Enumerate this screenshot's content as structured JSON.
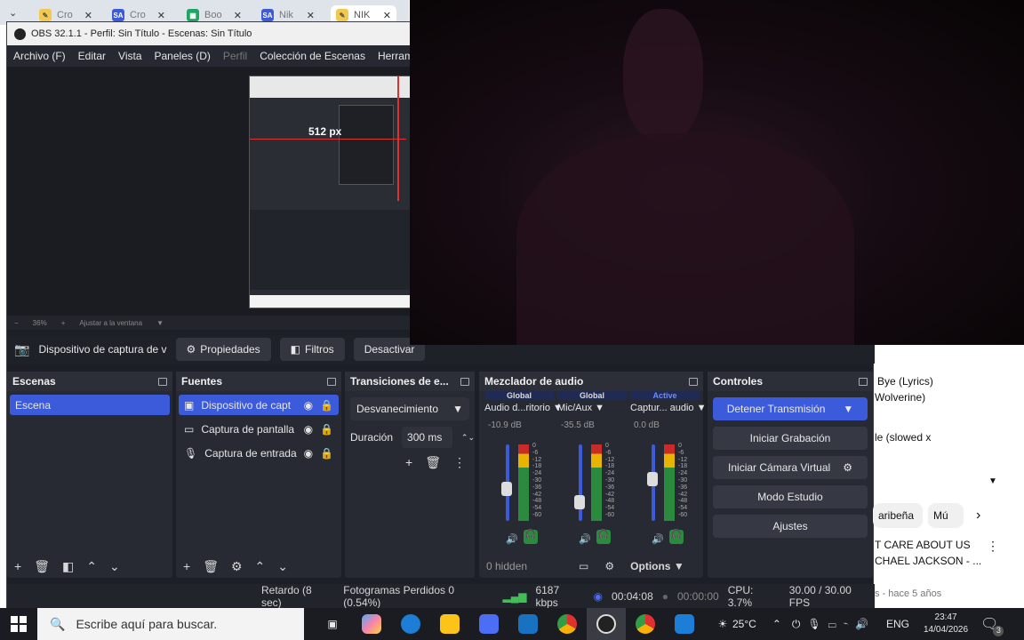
{
  "browser_tabs": [
    {
      "label": "Cro",
      "fav": "",
      "fav_color": "#f2c94c"
    },
    {
      "label": "Cro",
      "fav": "SA",
      "fav_color": "#3b5bdb"
    },
    {
      "label": "Boo",
      "fav": "",
      "fav_color": "#1fa463"
    },
    {
      "label": "Nik",
      "fav": "SA",
      "fav_color": "#3b5bdb"
    },
    {
      "label": "NIK",
      "fav": "",
      "fav_color": "#f2c94c"
    }
  ],
  "obs": {
    "title": "OBS 32.1.1 - Perfil: Sin Título - Escenas: Sin Título",
    "menu": [
      "Archivo (F)",
      "Editar",
      "Vista",
      "Paneles (D)",
      "Perfil",
      "Colección de Escenas",
      "Herramie"
    ],
    "preview_overlay_text": "512 px",
    "zoom": {
      "value": "36%",
      "fit": "Ajustar a la ventana"
    },
    "source_toolbar": {
      "source_name": "Dispositivo de captura de v",
      "properties": "Propiedades",
      "filters": "Filtros",
      "deactivate": "Desactivar"
    },
    "scenes": {
      "title": "Escenas",
      "items": [
        "Escena"
      ]
    },
    "sources": {
      "title": "Fuentes",
      "items": [
        {
          "label": "Dispositivo de capt",
          "icon": "camera-icon"
        },
        {
          "label": "Captura de pantalla",
          "icon": "monitor-icon"
        },
        {
          "label": "Captura de entrada",
          "icon": "microphone-icon"
        }
      ]
    },
    "transitions": {
      "title": "Transiciones de e...",
      "selected": "Desvanecimiento",
      "duration_label": "Duración",
      "duration_value": "300 ms"
    },
    "mixer": {
      "title": "Mezclador de audio",
      "channels": [
        {
          "tag": "Global",
          "name": "Audio d...ritorio",
          "db": "-10.9 dB",
          "level": 0.42
        },
        {
          "tag": "Global",
          "name": "Mic/Aux",
          "db": "-35.5 dB",
          "level": 0.25
        },
        {
          "tag": "Active",
          "name": "Captur... audio",
          "db": "0.0 dB",
          "level": 0.55
        }
      ],
      "scale": [
        "0",
        "-6",
        "-12",
        "-18",
        "-24",
        "-30",
        "-36",
        "-42",
        "-48",
        "-54",
        "-60"
      ],
      "hidden": "0 hidden",
      "options": "Options"
    },
    "controls": {
      "title": "Controles",
      "stop_stream": "Detener Transmisión",
      "start_record": "Iniciar Grabación",
      "virtual_cam": "Iniciar Cámara Virtual",
      "studio_mode": "Modo Estudio",
      "settings": "Ajustes"
    },
    "status": {
      "delay": "Retardo (8 sec)",
      "dropped": "Fotogramas Perdidos 0 (0.54%)",
      "bitrate": "6187 kbps",
      "stream_time": "00:04:08",
      "rec_time": "00:00:00",
      "cpu": "CPU: 3.7%",
      "fps": "30.00 / 30.00 FPS"
    }
  },
  "youtube": {
    "line1": "Bye (Lyrics)",
    "line2": "Wolverine)",
    "line3": "le (slowed x",
    "chips": [
      "aribeña",
      "Mú"
    ],
    "title1": "T CARE ABOUT US",
    "title2": "CHAEL JACKSON - ...",
    "meta": "s - hace 5 años"
  },
  "taskbar": {
    "search_placeholder": "Escribe aquí para buscar.",
    "weather": "25°C",
    "lang": "ENG",
    "time": "23:47",
    "date": "14/04/2026",
    "notif_count": "3"
  }
}
